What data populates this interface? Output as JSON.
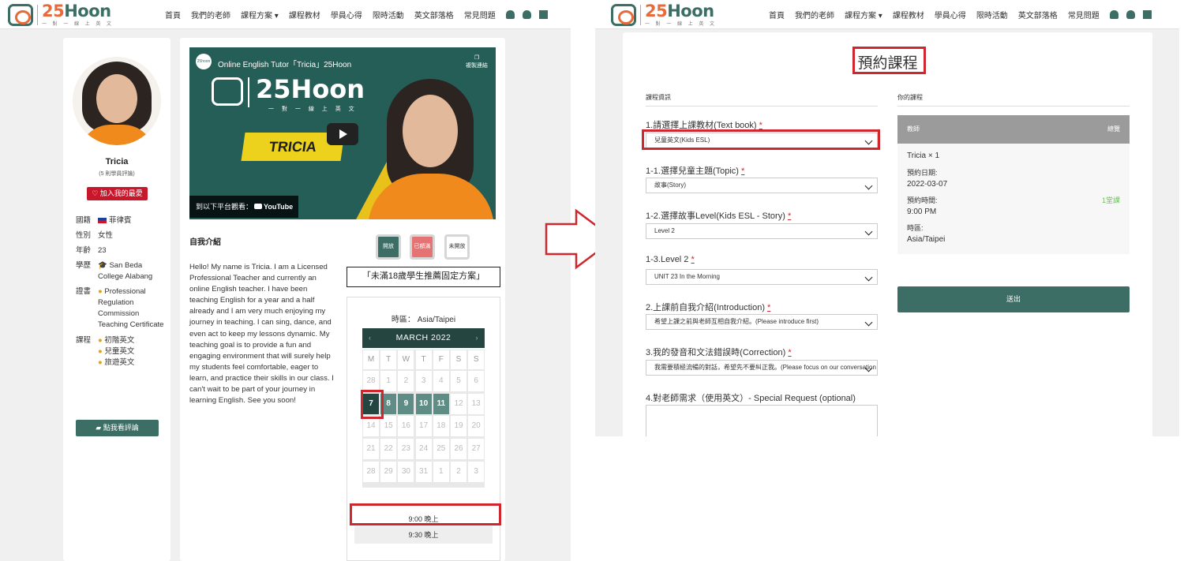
{
  "nav": {
    "brand_prefix": "25",
    "brand_suffix": "Hoon",
    "tagline": "一 對 一 線 上 英 文",
    "items": [
      "首頁",
      "我們的老師",
      "課程方案 ▾",
      "課程教材",
      "學員心得",
      "限時活動",
      "英文部落格",
      "常見問題"
    ]
  },
  "teacher": {
    "name": "Tricia",
    "reviews": "(5 則學員評論)",
    "favorite_label": "加入我的最愛",
    "info": [
      {
        "key": "國籍",
        "value": "菲律賓",
        "icon": "philippines-flag-icon"
      },
      {
        "key": "性別",
        "value": "女性"
      },
      {
        "key": "年齡",
        "value": "23"
      },
      {
        "key": "學歷",
        "value": "San Beda College Alabang",
        "icon": "graduation-cap-icon"
      },
      {
        "key": "證書",
        "value": "Professional Regulation Commission Teaching Certificate",
        "icon": "medal-icon"
      }
    ],
    "courses_label": "課程",
    "courses": [
      "初階英文",
      "兒童英文",
      "旅遊英文"
    ],
    "review_button": "點我看評論"
  },
  "video": {
    "title": "Online English Tutor「Tricia」25Hoon",
    "copy_link": "複製連結",
    "badge_name": "TRICIA",
    "watch_on": "到以下平台觀看：",
    "youtube": "YouTube",
    "channel_badge": "25hoon",
    "video_tagline": "一 對 一 線 上 英 文"
  },
  "intro": {
    "heading": "自我介紹",
    "text": "Hello! My name is Tricia. I am a Licensed Professional Teacher and currently an online English teacher. I have been teaching English for a year and a half already and I am very much enjoying my journey in teaching. I can sing, dance, and even act to keep my lessons dynamic. My teaching goal is to provide a fun and engaging environment that will surely help my students feel comfortable, eager to learn, and practice their skills in our class. I can't wait to be part of your journey in learning English. See you soon!"
  },
  "legend": {
    "open": "開放",
    "full": "已額滿",
    "closed": "未開放"
  },
  "plan_button": "「未滿18歲學生推薦固定方案」",
  "calendar": {
    "timezone_label": "時區：",
    "timezone": "Asia/Taipei",
    "month": "MARCH 2022",
    "prev": "‹",
    "next": "›",
    "weekdays": [
      "M",
      "T",
      "W",
      "T",
      "F",
      "S",
      "S"
    ],
    "weeks": [
      [
        "28",
        "1",
        "2",
        "3",
        "4",
        "5",
        "6"
      ],
      [
        "7",
        "8",
        "9",
        "10",
        "11",
        "12",
        "13"
      ],
      [
        "14",
        "15",
        "16",
        "17",
        "18",
        "19",
        "20"
      ],
      [
        "21",
        "22",
        "23",
        "24",
        "25",
        "26",
        "27"
      ],
      [
        "28",
        "29",
        "30",
        "31",
        "1",
        "2",
        "3"
      ]
    ],
    "selected": "7",
    "available": [
      "8",
      "9",
      "10",
      "11"
    ],
    "slots": [
      "9:00 晚上",
      "9:30 晚上"
    ]
  },
  "arrow": {
    "colors": {
      "stroke": "#d0262d"
    }
  },
  "booking": {
    "title": "預約課程",
    "section_label": "課程資訊",
    "questions": [
      {
        "label": "1.請選擇上課教材(Text book)",
        "value": "兒童英文(Kids ESL)"
      },
      {
        "label": "1-1.選擇兒童主題(Topic)",
        "value": "故事(Story)"
      },
      {
        "label": "1-2.選擇故事Level(Kids ESL - Story)",
        "value": "Level 2"
      },
      {
        "label": "1-3.Level 2",
        "value": "UNIT 23 In the Morning"
      },
      {
        "label": "2.上課前自我介紹(Introduction)",
        "value": "希望上課之前與老師互相自我介紹。(Please introduce first)"
      },
      {
        "label": "3.我的發音和文法錯誤時(Correction)",
        "value": "我需要積極流暢的對話，希望先不要糾正我。(Please focus on our conversation first)"
      }
    ],
    "required_mark": "*",
    "special_request": "4.對老師需求（使用英文）- Special Request (optional)",
    "your_course": "你的課程",
    "table": {
      "col_teacher": "教師",
      "col_total": "總覽"
    },
    "course_teacher": "Tricia × 1",
    "date_label": "預約日期:",
    "date": "2022-03-07",
    "time_label": "預約時間:",
    "time": "9:00 PM",
    "lessons": "1堂課",
    "tz_label": "時區:",
    "tz": "Asia/Taipei",
    "submit": "送出"
  },
  "colors": {
    "accent": "#3c6e66",
    "brand": "#e66a3a",
    "highlight": "#d0262d",
    "full": "#e57373"
  }
}
